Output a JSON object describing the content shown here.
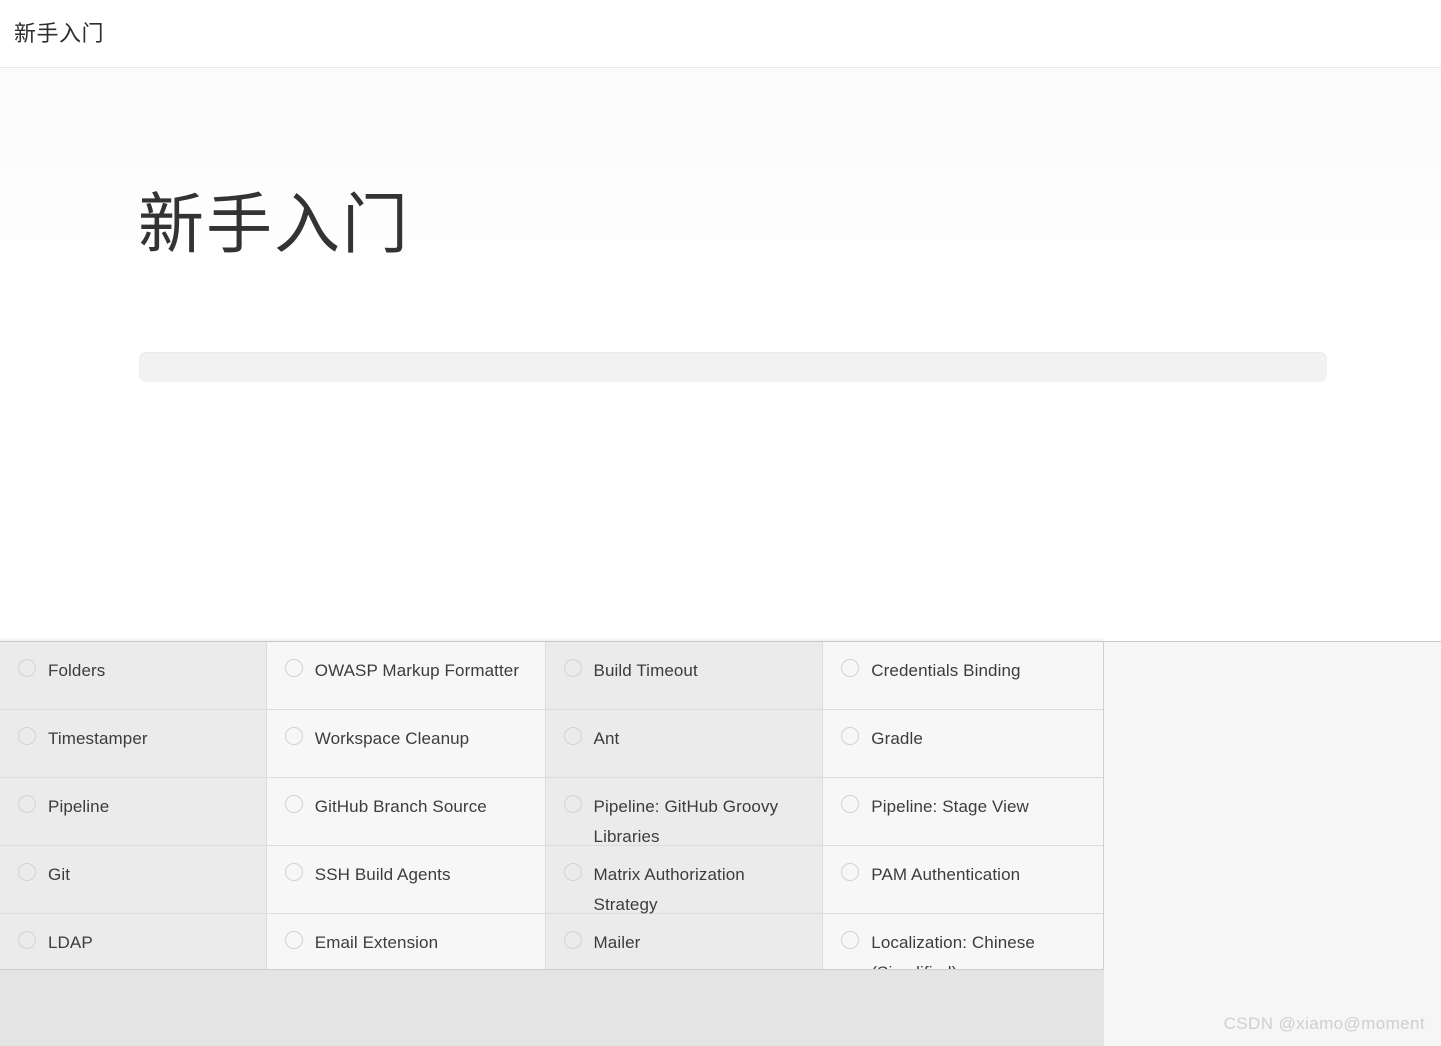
{
  "header": {
    "title": "新手入门"
  },
  "wizard": {
    "heading": "新手入门",
    "progress": {
      "percent": 0,
      "label": ""
    }
  },
  "plugin_grid": {
    "columns": [
      {
        "index": 0,
        "items": [
          {
            "label": "Folders",
            "selected": false
          },
          {
            "label": "Timestamper",
            "selected": false
          },
          {
            "label": "Pipeline",
            "selected": false
          },
          {
            "label": "Git",
            "selected": false
          },
          {
            "label": "LDAP",
            "selected": false
          }
        ]
      },
      {
        "index": 1,
        "items": [
          {
            "label": "OWASP Markup Formatter",
            "selected": false
          },
          {
            "label": "Workspace Cleanup",
            "selected": false
          },
          {
            "label": "GitHub Branch Source",
            "selected": false
          },
          {
            "label": "SSH Build Agents",
            "selected": false
          },
          {
            "label": "Email Extension",
            "selected": false
          }
        ]
      },
      {
        "index": 2,
        "items": [
          {
            "label": "Build Timeout",
            "selected": false
          },
          {
            "label": "Ant",
            "selected": false
          },
          {
            "label": "Pipeline: GitHub Groovy Libraries",
            "selected": false
          },
          {
            "label": "Matrix Authorization Strategy",
            "selected": false
          },
          {
            "label": "Mailer",
            "selected": false
          }
        ]
      },
      {
        "index": 3,
        "items": [
          {
            "label": "Credentials Binding",
            "selected": false
          },
          {
            "label": "Gradle",
            "selected": false
          },
          {
            "label": "Pipeline: Stage View",
            "selected": false
          },
          {
            "label": "PAM Authentication",
            "selected": false
          },
          {
            "label": "Localization: Chinese (Simplified)",
            "selected": false
          }
        ]
      }
    ]
  },
  "watermark": {
    "text": "CSDN @xiamo@moment"
  },
  "colors": {
    "page_background": "#ffffff",
    "header_border": "#e8e8e8",
    "text_primary": "#333333",
    "text_secondary": "#3c3c3c",
    "column_dark": "#ebebeb",
    "column_light": "#f7f7f7",
    "cell_border": "#dcdcdc",
    "footer_background": "#e4e4e4",
    "progress_track": "#f2f2f2",
    "watermark_text": "#cfcfcf"
  }
}
